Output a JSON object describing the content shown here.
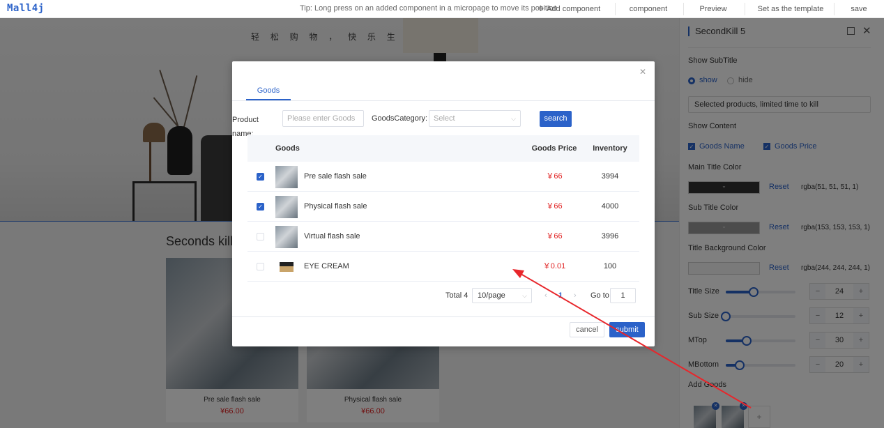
{
  "app": {
    "logo": "Mall4j",
    "tip": "Tip: Long press on an added component in a micropage to move its position",
    "toolbar": {
      "add_component": "Add component",
      "component": "component",
      "preview": "Preview",
      "set_template": "Set as the template",
      "save": "save"
    }
  },
  "canvas": {
    "banner_text": "轻 松 购 物 ， 快 乐 生 活",
    "section_title": "Seconds kill",
    "products": [
      {
        "name": "Pre sale flash sale",
        "price": "¥66.00"
      },
      {
        "name": "Physical flash sale",
        "price": "¥66.00"
      }
    ]
  },
  "panel": {
    "title": "SecondKill 5",
    "show_subtitle_label": "Show SubTitle",
    "show_option": "show",
    "hide_option": "hide",
    "subtitle_value": "Selected products, limited time to kill",
    "show_content_label": "Show Content",
    "goods_name": "Goods Name",
    "goods_price": "Goods Price",
    "main_title_color_label": "Main Title Color",
    "main_title_color": "rgba(51, 51, 51, 1)",
    "sub_title_color_label": "Sub Title Color",
    "sub_title_color": "rgba(153, 153, 153, 1)",
    "title_bg_color_label": "Title Background Color",
    "title_bg_color": "rgba(244, 244, 244, 1)",
    "reset": "Reset",
    "title_size_label": "Title Size",
    "title_size": "24",
    "title_size_level": 0.4,
    "sub_size_label": "Sub Size",
    "sub_size": "12",
    "sub_size_level": 0.0,
    "mtop_label": "MTop",
    "mtop": "30",
    "mtop_level": 0.3,
    "mbottom_label": "MBottom",
    "mbottom": "20",
    "mbottom_level": 0.2,
    "add_goods_label": "Add Goods",
    "minus": "−",
    "plus": "+"
  },
  "modal": {
    "tab": "Goods",
    "product_name_label": "Product name:",
    "product_name_placeholder": "Please enter Goods",
    "category_label": "GoodsCategory:",
    "category_placeholder": "Select",
    "search_button": "search",
    "columns": {
      "goods": "Goods",
      "price": "Goods Price",
      "inventory": "Inventory"
    },
    "rows": [
      {
        "name": "Pre sale flash sale",
        "price": "￥66",
        "inventory": "3994",
        "checked": true
      },
      {
        "name": "Physical flash sale",
        "price": "￥66",
        "inventory": "4000",
        "checked": true
      },
      {
        "name": "Virtual flash sale",
        "price": "￥66",
        "inventory": "3996",
        "checked": false
      },
      {
        "name": "EYE CREAM",
        "price": "￥0.01",
        "inventory": "100",
        "checked": false
      }
    ],
    "pagination": {
      "total": "Total 4",
      "page_size": "10/page",
      "current_page": "1",
      "goto_label": "Go to",
      "goto_value": "1"
    },
    "cancel_button": "cancel",
    "submit_button": "submit"
  },
  "colors": {
    "accent": "#2b62c9",
    "price_red": "#e02020",
    "annotation_arrow": "#e8262b"
  }
}
